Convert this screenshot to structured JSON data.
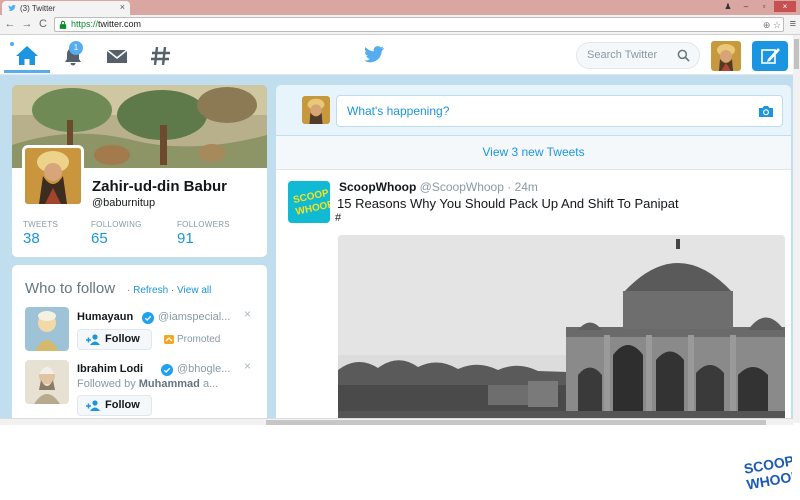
{
  "browser": {
    "tab_title": "(3) Twitter",
    "tab_close": "×",
    "url_protocol": "https://",
    "url_host": "twitter.com",
    "back": "←",
    "forward": "→",
    "reload": "C",
    "omni_icons": "⊕ ☆",
    "menu": "≡",
    "win_min": "–",
    "win_max": "▫",
    "win_close": "×",
    "user_icon": "♟"
  },
  "nav": {
    "notifications_count": "1",
    "search_placeholder": "Search Twitter",
    "accent_color": "#55acee"
  },
  "profile": {
    "name": "Zahir-ud-din Babur",
    "handle": "@baburnitup",
    "stats": [
      {
        "label": "TWEETS",
        "value": "38"
      },
      {
        "label": "FOLLOWING",
        "value": "65"
      },
      {
        "label": "FOLLOWERS",
        "value": "91"
      }
    ]
  },
  "who_to_follow": {
    "title": "Who to follow",
    "sep1": "·",
    "refresh": "Refresh",
    "sep2": "·",
    "view_all": "View all",
    "dismiss": "×",
    "suggestions": [
      {
        "name": "Humayaun",
        "handle": "@iamspecial...",
        "button": "Follow",
        "note": "Promoted"
      },
      {
        "name": "Ibrahim Lodi",
        "handle": "@bhogle...",
        "button": "Follow",
        "followed_by_prefix": "Followed by",
        "followed_by_name": "Muhammad",
        "followed_by_suffix": "a..."
      }
    ]
  },
  "timeline": {
    "compose_placeholder": "What's happening?",
    "new_tweets": "View 3 new Tweets",
    "tweet": {
      "author": "ScoopWhoop",
      "handle": "@ScoopWhoop",
      "time": "· 24m",
      "text": "15 Reasons Why You Should Pack Up And Shift To Panipat",
      "hashtag": "#",
      "avatar_text": "SCOOP WHOOP"
    }
  },
  "watermark": {
    "line1": "SCOOP",
    "line2": "WHOOP",
    "color": "#1a5ab5"
  }
}
